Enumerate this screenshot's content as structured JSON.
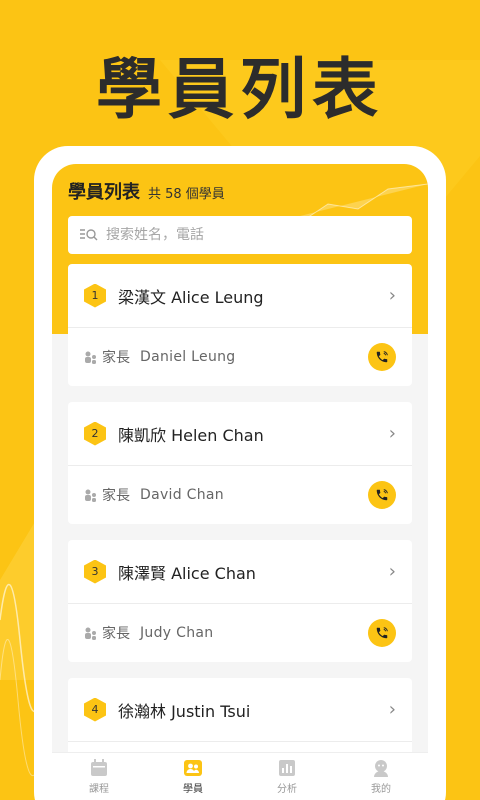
{
  "hero": {
    "title": "學員列表"
  },
  "header": {
    "title": "學員列表",
    "count": "共 58 個學員"
  },
  "search": {
    "placeholder": "搜索姓名，電話"
  },
  "parent_label": "家長",
  "students": [
    {
      "index": "1",
      "name": "梁漢文 Alice Leung",
      "parent": "Daniel Leung"
    },
    {
      "index": "2",
      "name": "陳凱欣 Helen Chan",
      "parent": "David Chan"
    },
    {
      "index": "3",
      "name": "陳澤賢 Alice Chan",
      "parent": "Judy Chan"
    },
    {
      "index": "4",
      "name": "徐瀚林 Justin Tsui",
      "parent": ""
    }
  ],
  "tabs": [
    {
      "label": "課程",
      "icon": "calendar-icon",
      "active": false
    },
    {
      "label": "學員",
      "icon": "people-icon",
      "active": true
    },
    {
      "label": "分析",
      "icon": "chart-icon",
      "active": false
    },
    {
      "label": "我的",
      "icon": "profile-icon",
      "active": false
    }
  ],
  "colors": {
    "accent": "#fcc414",
    "text": "#222222",
    "muted": "#666666"
  }
}
